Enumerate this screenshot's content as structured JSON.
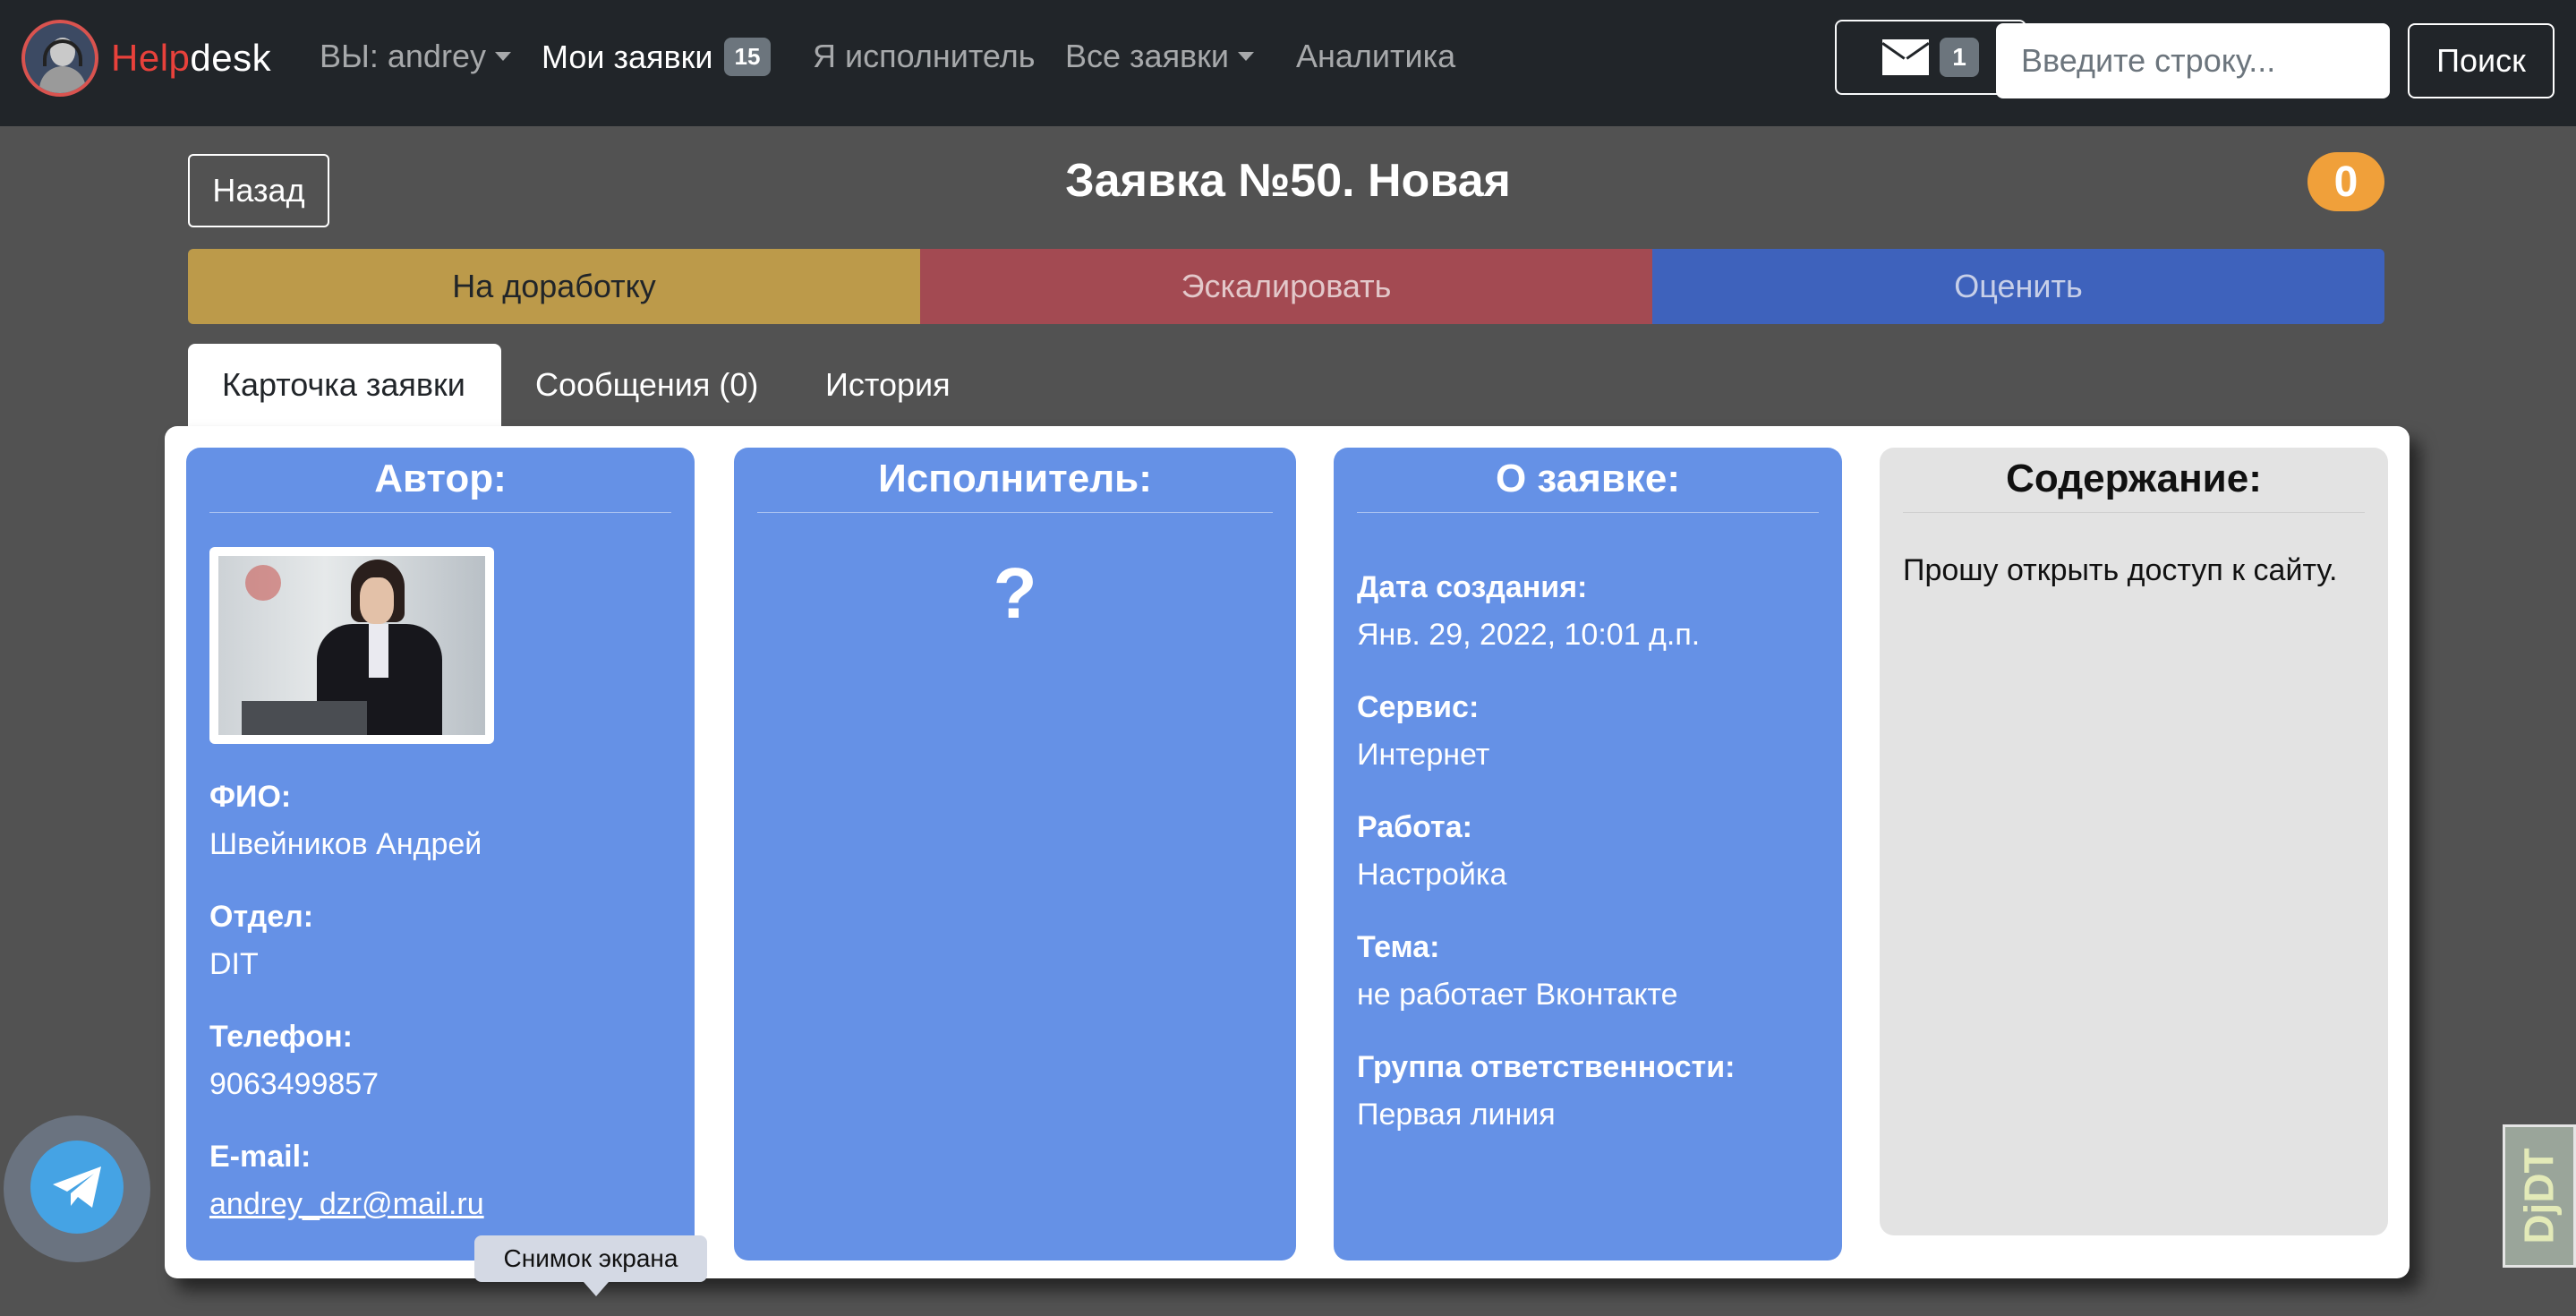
{
  "navbar": {
    "brand_prefix": "Help",
    "brand_suffix": "desk",
    "user_menu": "ВЫ: andrey",
    "my_requests": "Мои заявки",
    "my_requests_count": "15",
    "executor": "Я исполнитель",
    "all_requests": "Все заявки",
    "analytics": "Аналитика",
    "mail_count": "1",
    "search_placeholder": "Введите строку...",
    "search_button": "Поиск"
  },
  "header": {
    "back_button": "Назад",
    "title": "Заявка №50. Новая",
    "badge": "0"
  },
  "actions": {
    "rework": "На доработку",
    "escalate": "Эскалировать",
    "rate": "Оценить"
  },
  "tabs": [
    {
      "label": "Карточка заявки"
    },
    {
      "label": "Сообщения (0)"
    },
    {
      "label": "История"
    }
  ],
  "author": {
    "heading": "Автор:",
    "fields": [
      {
        "label": "ФИО:",
        "value": "Швейников Андрей"
      },
      {
        "label": "Отдел:",
        "value": "DIT"
      },
      {
        "label": "Телефон:",
        "value": "9063499857"
      },
      {
        "label": "E-mail:",
        "value": "andrey_dzr@mail.ru"
      }
    ]
  },
  "executor_card": {
    "heading": "Исполнитель:",
    "placeholder": "?"
  },
  "about": {
    "heading": "О заявке:",
    "fields": [
      {
        "label": "Дата создания:",
        "value": "Янв. 29, 2022, 10:01 д.п."
      },
      {
        "label": "Сервис:",
        "value": "Интернет"
      },
      {
        "label": "Работа:",
        "value": "Настройка"
      },
      {
        "label": "Тема:",
        "value": "не работает Вконтакте"
      },
      {
        "label": "Группа ответственности:",
        "value": "Первая линия"
      }
    ]
  },
  "content_card": {
    "heading": "Содержание:",
    "text": "Прошу открыть доступ к сайту."
  },
  "overlays": {
    "tooltip": "Снимок экрана",
    "debug_toolbar": "DjDT",
    "telegram_icon": "telegram-icon"
  }
}
